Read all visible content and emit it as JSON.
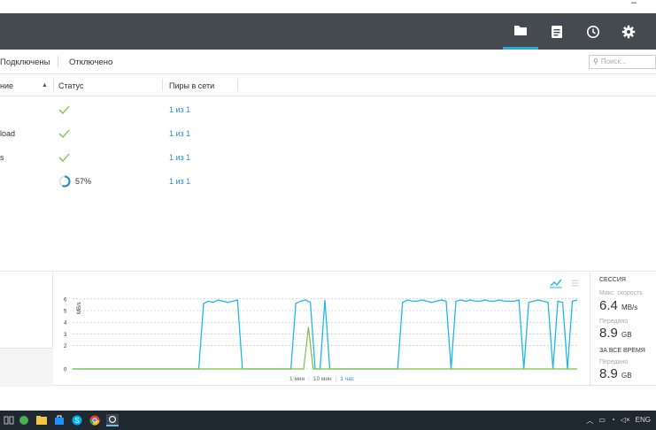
{
  "window": {
    "minimize_glyph": "–"
  },
  "toolbar": {
    "buttons": [
      {
        "name": "folder-icon",
        "active": true
      },
      {
        "name": "document-icon",
        "active": false
      },
      {
        "name": "clock-icon",
        "active": false
      },
      {
        "name": "gear-icon",
        "active": false
      }
    ]
  },
  "filters": {
    "connected": "Подключены",
    "disabled": "Отключено"
  },
  "search": {
    "placeholder": "Поиск..."
  },
  "columns": {
    "name": "ние",
    "status": "Статус",
    "peers": "Пиры в сети",
    "sort_glyph": "▲"
  },
  "rows": [
    {
      "name": "",
      "status_type": "done",
      "status_text": "",
      "peers": "1 из 1"
    },
    {
      "name": "load",
      "status_type": "done",
      "status_text": "",
      "peers": "1 из 1"
    },
    {
      "name": "s",
      "status_type": "done",
      "status_text": "",
      "peers": "1 из 1"
    },
    {
      "name": "",
      "status_type": "progress",
      "status_text": "57%",
      "progress": 0.57,
      "peers": "1 из 1"
    }
  ],
  "graph": {
    "unit": "MB/s",
    "y_ticks": [
      "0",
      "2",
      "3",
      "4",
      "5",
      "6"
    ],
    "range_options": [
      "1 мин",
      "10 мин",
      "1 час"
    ],
    "active_range": "1 час",
    "colors": {
      "download": "#1fb8ea",
      "upload": "#7cc142"
    }
  },
  "chart_data": {
    "type": "area",
    "ylabel": "MB/s",
    "ylim": [
      0,
      6
    ],
    "series": [
      {
        "values": [
          0,
          0,
          0,
          0,
          0,
          0,
          0,
          0,
          0,
          0,
          0,
          0,
          0,
          0,
          0,
          0,
          0,
          0,
          0,
          0,
          0,
          0,
          0,
          0,
          0,
          0,
          0,
          5.6,
          5.8,
          5.7,
          5.9,
          5.8,
          5.7,
          5.8,
          5.9,
          0,
          0,
          0,
          0,
          0,
          0,
          0,
          0,
          0,
          0,
          0,
          5.6,
          5.8,
          5.9,
          5.7,
          0,
          0,
          5.9,
          0,
          0,
          0,
          0,
          0,
          0,
          0,
          0,
          0,
          0,
          0,
          0,
          0,
          0,
          0,
          5.7,
          5.9,
          5.8,
          5.8,
          5.9,
          5.8,
          5.7,
          5.8,
          5.9,
          5.8,
          0,
          5.8,
          5.9,
          5.8,
          5.9,
          5.8,
          5.8,
          5.9,
          5.8,
          5.8,
          5.9,
          5.8,
          5.8,
          5.8,
          5.9,
          0,
          5.7,
          5.8,
          5.9,
          5.8,
          5.7,
          0,
          5.8,
          5.7,
          0,
          5.8,
          5.9
        ]
      },
      {
        "values": [
          0,
          0,
          0,
          0,
          0,
          0,
          0,
          0,
          0,
          0,
          0,
          0,
          0,
          0,
          0,
          0,
          0,
          0,
          0,
          0,
          0,
          0,
          0,
          0,
          0,
          0,
          0,
          0,
          0,
          0,
          0,
          0,
          0,
          0,
          0,
          0,
          0,
          0,
          0,
          0,
          0,
          0,
          0,
          0,
          0,
          0,
          0,
          0,
          0,
          0,
          3.6,
          0,
          0,
          0,
          0,
          0,
          0,
          0,
          0,
          0,
          0,
          0,
          0,
          0,
          0,
          0,
          0,
          0,
          0,
          0,
          0,
          0,
          0,
          0,
          0,
          0,
          0,
          0,
          0,
          0,
          0,
          0,
          0,
          0,
          0,
          0,
          0,
          0,
          0,
          0,
          0,
          0,
          0,
          0,
          0,
          0,
          0,
          0,
          0,
          0,
          0,
          0,
          0,
          0,
          0,
          0,
          0,
          0
        ]
      }
    ]
  },
  "stats": {
    "session_label": "СЕССИЯ",
    "max_speed_label": "Макс. скорость",
    "max_speed_value": "6.4",
    "max_speed_unit": "MB/s",
    "sent_label": "Передано",
    "sent_value": "8.9",
    "sent_unit": "GB",
    "all_time_label": "ЗА ВСЕ ВРЕМЯ",
    "all_sent_label": "Передано",
    "all_sent_value": "8.9",
    "all_sent_unit": "GB"
  },
  "taskbar": {
    "tray_text": "ENG",
    "tray_icons": [
      "chevron-up-icon",
      "battery-icon",
      "network-icon",
      "volume-icon"
    ]
  }
}
